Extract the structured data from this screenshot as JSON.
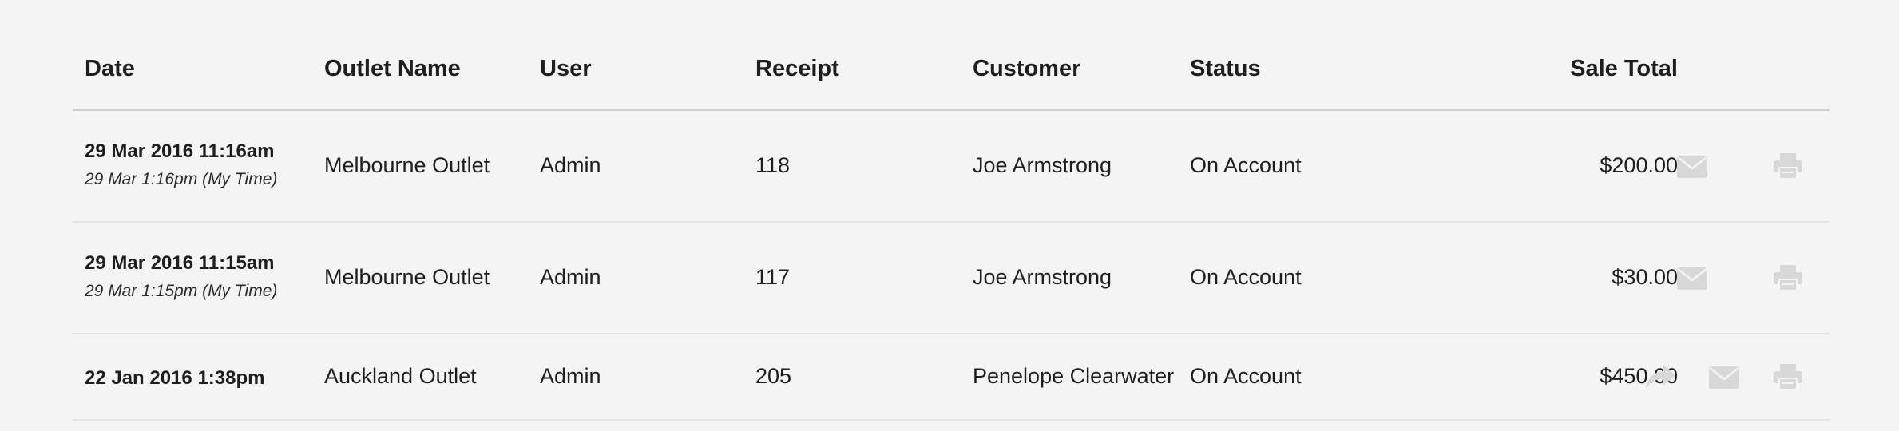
{
  "columns": {
    "date": "Date",
    "outlet": "Outlet Name",
    "user": "User",
    "receipt": "Receipt",
    "customer": "Customer",
    "status": "Status",
    "total": "Sale Total"
  },
  "rows": [
    {
      "date": "29 Mar 2016 11:16am",
      "date_local": "29 Mar 1:16pm (My Time)",
      "outlet": "Melbourne Outlet",
      "user": "Admin",
      "receipt": "118",
      "customer": "Joe Armstrong",
      "status": "On Account",
      "total": "$200.00",
      "actions": [
        "envelope-icon",
        "printer-icon"
      ]
    },
    {
      "date": "29 Mar 2016 11:15am",
      "date_local": "29 Mar 1:15pm (My Time)",
      "outlet": "Melbourne Outlet",
      "user": "Admin",
      "receipt": "117",
      "customer": "Joe Armstrong",
      "status": "On Account",
      "total": "$30.00",
      "actions": [
        "envelope-icon",
        "printer-icon"
      ]
    },
    {
      "date": "22 Jan 2016 1:38pm",
      "outlet": "Auckland Outlet",
      "user": "Admin",
      "receipt": "205",
      "customer": "Penelope Clearwater",
      "status": "On Account",
      "total": "$450.00",
      "actions": [
        "share-arrow-icon",
        "envelope-icon",
        "printer-icon"
      ]
    }
  ],
  "colors": {
    "background": "#f4f4f4",
    "text": "#1e1e1e",
    "header_divider": "#cfcfcf",
    "row_divider": "#e3e3e3",
    "icon": "#d8d8d8"
  }
}
